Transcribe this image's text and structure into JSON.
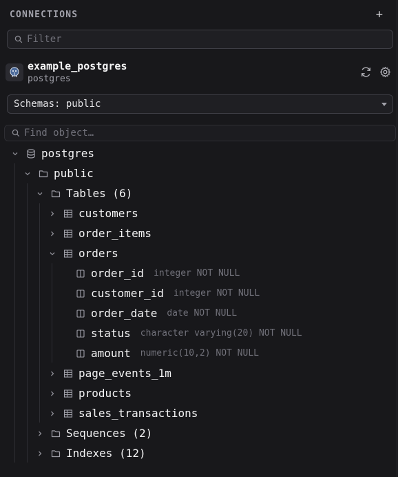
{
  "header": {
    "title": "CONNECTIONS",
    "add_label": "+"
  },
  "filter": {
    "placeholder": "Filter"
  },
  "connection": {
    "name": "example_postgres",
    "type": "postgres"
  },
  "schema_select": {
    "value": "Schemas: public"
  },
  "find": {
    "placeholder": "Find object…"
  },
  "tree": {
    "database": "postgres",
    "schema": "public",
    "tables_folder": "Tables (6)",
    "tables": [
      "customers",
      "order_items",
      "orders",
      "page_events_1m",
      "products",
      "sales_transactions"
    ],
    "columns": [
      {
        "name": "order_id",
        "type": "integer NOT NULL"
      },
      {
        "name": "customer_id",
        "type": "integer NOT NULL"
      },
      {
        "name": "order_date",
        "type": "date NOT NULL"
      },
      {
        "name": "status",
        "type": "character varying(20) NOT NULL"
      },
      {
        "name": "amount",
        "type": "numeric(10,2) NOT NULL"
      }
    ],
    "sequences_folder": "Sequences (2)",
    "indexes_folder": "Indexes (12)"
  },
  "colors": {
    "background": "#18181b",
    "text": "#f4f4f5",
    "muted": "#71717a",
    "border": "#3f3f46"
  }
}
